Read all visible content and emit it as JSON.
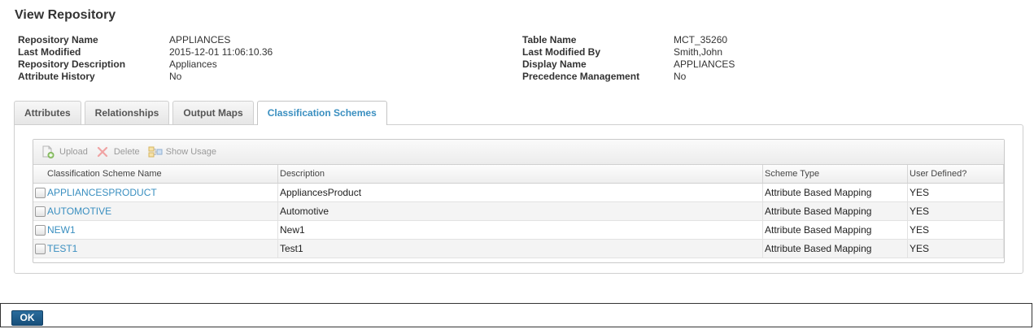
{
  "page": {
    "title": "View Repository"
  },
  "properties_left": [
    {
      "label": "Repository Name",
      "value": "APPLIANCES"
    },
    {
      "label": "Last Modified",
      "value": "2015-12-01 11:06:10.36"
    },
    {
      "label": "Repository Description",
      "value": "Appliances"
    },
    {
      "label": "Attribute History",
      "value": "No"
    }
  ],
  "properties_right": [
    {
      "label": "Table Name",
      "value": "MCT_35260"
    },
    {
      "label": "Last Modified By",
      "value": "Smith,John"
    },
    {
      "label": "Display Name",
      "value": "APPLIANCES"
    },
    {
      "label": "Precedence Management",
      "value": "No"
    }
  ],
  "tabs": [
    {
      "label": "Attributes",
      "active": false
    },
    {
      "label": "Relationships",
      "active": false
    },
    {
      "label": "Output Maps",
      "active": false
    },
    {
      "label": "Classification Schemes",
      "active": true
    }
  ],
  "toolbar": {
    "upload_label": "Upload",
    "delete_label": "Delete",
    "show_usage_label": "Show Usage"
  },
  "table": {
    "columns": [
      "Classification Scheme Name",
      "Description",
      "Scheme Type",
      "User Defined?"
    ],
    "rows": [
      {
        "name": "APPLIANCESPRODUCT",
        "description": "AppliancesProduct",
        "scheme_type": "Attribute Based Mapping",
        "user_defined": "YES"
      },
      {
        "name": "AUTOMOTIVE",
        "description": "Automotive",
        "scheme_type": "Attribute Based Mapping",
        "user_defined": "YES"
      },
      {
        "name": "NEW1",
        "description": "New1",
        "scheme_type": "Attribute Based Mapping",
        "user_defined": "YES"
      },
      {
        "name": "TEST1",
        "description": "Test1",
        "scheme_type": "Attribute Based Mapping",
        "user_defined": "YES"
      }
    ]
  },
  "footer": {
    "ok_label": "OK"
  },
  "colors": {
    "link": "#3a8fc0",
    "ok_button": "#1f5f8e"
  }
}
